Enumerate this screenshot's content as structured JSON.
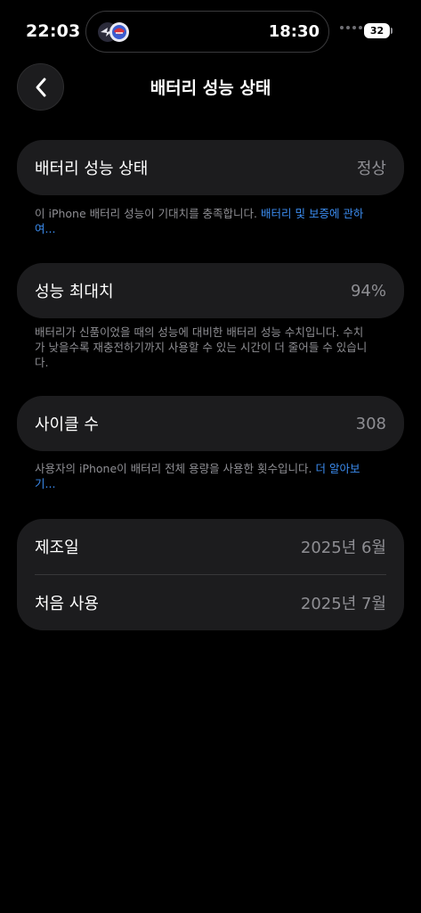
{
  "status_bar": {
    "time": "22:03",
    "island_time": "18:30",
    "battery_level": "32"
  },
  "nav": {
    "title": "배터리 성능 상태"
  },
  "battery_health": {
    "label": "배터리 성능 상태",
    "value": "정상",
    "note_text": "이 iPhone 배터리 성능이 기대치를 충족합니다. ",
    "note_link": "배터리 및 보증에 관하여..."
  },
  "max_capacity": {
    "label": "성능 최대치",
    "value": "94%",
    "note_text": "배터리가 신품이었을 때의 성능에 대비한 배터리 성능 수치입니다. 수치가 낮을수록 재충전하기까지 사용할 수 있는 시간이 더 줄어들 수 있습니다."
  },
  "cycle_count": {
    "label": "사이클 수",
    "value": "308",
    "note_text": "사용자의 iPhone이 배터리 전체 용량을 사용한 횟수입니다. ",
    "note_link": "더 알아보기..."
  },
  "dates": {
    "manufacture_label": "제조일",
    "manufacture_value": "2025년 6월",
    "first_use_label": "처음 사용",
    "first_use_value": "2025년 7월"
  },
  "colors": {
    "background": "#000000",
    "card": "#1c1c1e",
    "secondary_text": "#8e8e93",
    "link": "#3b8cf0"
  }
}
